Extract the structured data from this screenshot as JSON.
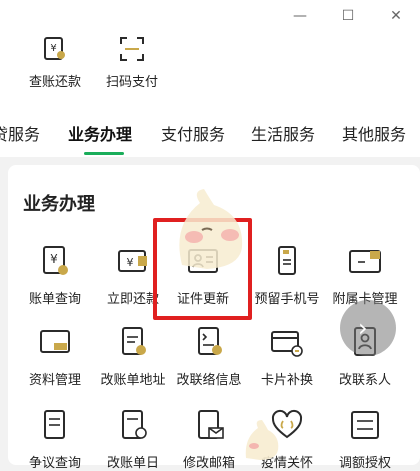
{
  "window_controls": {
    "minimize": "—",
    "maximize": "☐",
    "close": "✕"
  },
  "shortcuts": [
    {
      "label": "查账还款",
      "icon": "bill-search-icon"
    },
    {
      "label": "扫码支付",
      "icon": "scan-code-icon"
    }
  ],
  "tabs": [
    {
      "label": "贷服务",
      "active": false
    },
    {
      "label": "业务办理",
      "active": true
    },
    {
      "label": "支付服务",
      "active": false
    },
    {
      "label": "生活服务",
      "active": false
    },
    {
      "label": "其他服务",
      "active": false
    }
  ],
  "section": {
    "title": "业务办理",
    "items": [
      {
        "label": "账单查询",
        "icon": "bill-query-icon"
      },
      {
        "label": "立即还款",
        "icon": "instant-repay-icon"
      },
      {
        "label": "证件更新",
        "icon": "id-card-icon"
      },
      {
        "label": "预留手机号",
        "icon": "phone-icon"
      },
      {
        "label": "附属卡管理",
        "icon": "supplementary-card-icon"
      },
      {
        "label": "资料管理",
        "icon": "folder-icon"
      },
      {
        "label": "改账单地址",
        "icon": "address-edit-icon"
      },
      {
        "label": "改联络信息",
        "icon": "contact-edit-icon"
      },
      {
        "label": "卡片补换",
        "icon": "card-replace-icon"
      },
      {
        "label": "改联系人",
        "icon": "contact-person-icon"
      },
      {
        "label": "争议查询",
        "icon": "dispute-query-icon"
      },
      {
        "label": "改账单日",
        "icon": "bill-date-icon"
      },
      {
        "label": "修改邮箱",
        "icon": "email-icon"
      },
      {
        "label": "疫情关怀",
        "icon": "care-heart-icon"
      },
      {
        "label": "调额授权",
        "icon": "limit-adjust-icon"
      }
    ]
  },
  "colors": {
    "accent": "#1aad5a",
    "highlight": "#e02020",
    "icon_dark": "#2b2b2b",
    "icon_accent": "#c9a84a"
  }
}
